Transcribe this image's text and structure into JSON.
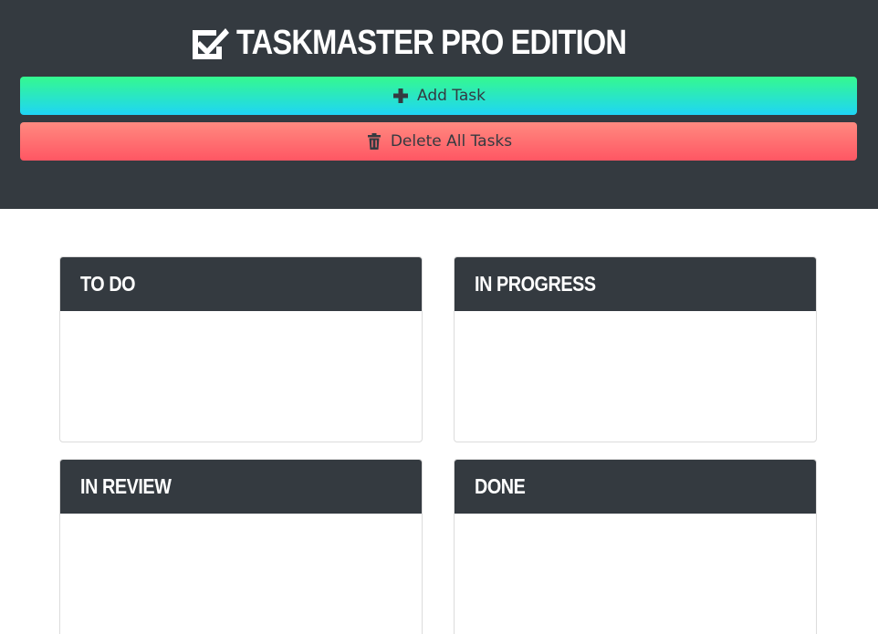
{
  "header": {
    "title": "TASKMASTER PRO EDITION",
    "logo_icon": "checkbox-checked-icon",
    "background": "#343a40"
  },
  "actions": {
    "add_label": "Add Task",
    "add_icon": "plus-icon",
    "add_gradient": [
      "#35f98f",
      "#1fd5f5"
    ],
    "delete_label": "Delete All Tasks",
    "delete_icon": "trash-icon",
    "delete_gradient": [
      "#ff8a80",
      "#ff5663"
    ]
  },
  "columns": [
    {
      "title": "TO DO",
      "tasks": []
    },
    {
      "title": "IN PROGRESS",
      "tasks": []
    },
    {
      "title": "IN REVIEW",
      "tasks": []
    },
    {
      "title": "DONE",
      "tasks": []
    }
  ]
}
